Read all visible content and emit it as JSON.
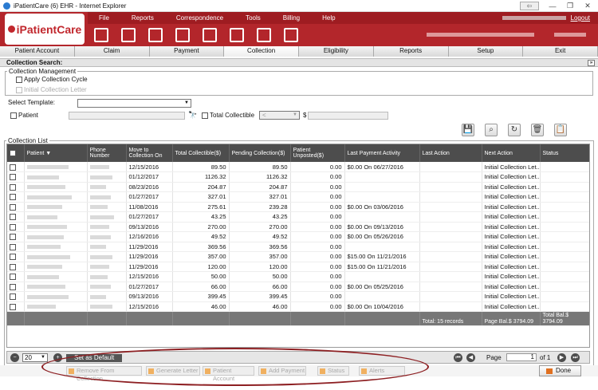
{
  "window": {
    "title": "iPatientCare (6) EHR - Internet Explorer",
    "minimize": "—",
    "restore": "❐",
    "close": "✕"
  },
  "app": {
    "logo": "iPatientCare",
    "menu": [
      "File",
      "Reports",
      "Correspondence",
      "Tools",
      "Billing",
      "Help"
    ],
    "logout": "Logout",
    "toolbar_icons": [
      "clipboard-icon",
      "dashboard-icon",
      "folder-icon",
      "calendar-icon",
      "document-icon",
      "mail-icon",
      "billing-icon",
      "chart-icon"
    ]
  },
  "nav_tabs": [
    "Patient Account",
    "Claim",
    "Payment",
    "Collection",
    "Eligibility",
    "Reports",
    "Setup",
    "Exit"
  ],
  "section_title": "Collection Search:",
  "management": {
    "legend": "Collection Management",
    "apply_cycle": "Apply Collection Cycle",
    "initial_letter": "Initial Collection Letter"
  },
  "filters": {
    "select_template": "Select Template:",
    "patient": "Patient",
    "total_collectible": "Total Collectible",
    "operator": "<",
    "currency": "$"
  },
  "grid": {
    "legend": "Collection List",
    "columns": [
      "",
      "Patient ▼",
      "Phone Number",
      "Move to Collection On",
      "Total Collectible($)",
      "Pending Collection($)",
      "Patient Unposted($)",
      "Last Payment Activity",
      "Last Action",
      "Next Action",
      "Status"
    ],
    "rows": [
      {
        "date": "12/15/2016",
        "total": "89.50",
        "pending": "89.50",
        "unposted": "0.00",
        "last_payment": "$0.00 On 06/27/2016",
        "next": "Initial Collection Let..."
      },
      {
        "date": "01/12/2017",
        "total": "1126.32",
        "pending": "1126.32",
        "unposted": "0.00",
        "last_payment": "",
        "next": "Initial Collection Let..."
      },
      {
        "date": "08/23/2016",
        "total": "204.87",
        "pending": "204.87",
        "unposted": "0.00",
        "last_payment": "",
        "next": "Initial Collection Let..."
      },
      {
        "date": "01/27/2017",
        "total": "327.01",
        "pending": "327.01",
        "unposted": "0.00",
        "last_payment": "",
        "next": "Initial Collection Let..."
      },
      {
        "date": "11/08/2016",
        "total": "275.61",
        "pending": "239.28",
        "unposted": "0.00",
        "last_payment": "$0.00 On 03/06/2016",
        "next": "Initial Collection Let..."
      },
      {
        "date": "01/27/2017",
        "total": "43.25",
        "pending": "43.25",
        "unposted": "0.00",
        "last_payment": "",
        "next": "Initial Collection Let..."
      },
      {
        "date": "09/13/2016",
        "total": "270.00",
        "pending": "270.00",
        "unposted": "0.00",
        "last_payment": "$0.00 On 09/13/2016",
        "next": "Initial Collection Let..."
      },
      {
        "date": "12/16/2016",
        "total": "49.52",
        "pending": "49.52",
        "unposted": "0.00",
        "last_payment": "$0.00 On 05/26/2016",
        "next": "Initial Collection Let..."
      },
      {
        "date": "11/29/2016",
        "total": "369.56",
        "pending": "369.56",
        "unposted": "0.00",
        "last_payment": "",
        "next": "Initial Collection Let..."
      },
      {
        "date": "11/29/2016",
        "total": "357.00",
        "pending": "357.00",
        "unposted": "0.00",
        "last_payment": "$15.00 On 11/21/2016",
        "next": "Initial Collection Let..."
      },
      {
        "date": "11/29/2016",
        "total": "120.00",
        "pending": "120.00",
        "unposted": "0.00",
        "last_payment": "$15.00 On 11/21/2016",
        "next": "Initial Collection Let..."
      },
      {
        "date": "12/15/2016",
        "total": "50.00",
        "pending": "50.00",
        "unposted": "0.00",
        "last_payment": "",
        "next": "Initial Collection Let..."
      },
      {
        "date": "01/27/2017",
        "total": "66.00",
        "pending": "66.00",
        "unposted": "0.00",
        "last_payment": "$0.00 On 05/25/2016",
        "next": "Initial Collection Let..."
      },
      {
        "date": "09/13/2016",
        "total": "399.45",
        "pending": "399.45",
        "unposted": "0.00",
        "last_payment": "",
        "next": "Initial Collection Let..."
      },
      {
        "date": "12/15/2016",
        "total": "46.00",
        "pending": "46.00",
        "unposted": "0.00",
        "last_payment": "$0.00 On 10/04/2016",
        "next": "Initial Collection Let..."
      }
    ],
    "totals": {
      "records": "Total: 15 records",
      "page_bal": "Page Bal.$ 3794.09",
      "total_bal": "Total Bal.$ 3794.09"
    }
  },
  "pager": {
    "page_size": "20",
    "set_default": "Set as Default",
    "page_label": "Page",
    "page_value": "1",
    "of": "of 1"
  },
  "actions": [
    "Remove From Collection",
    "Generate Letter",
    "Patient Account",
    "Add Payment",
    "Status",
    "Alerts"
  ],
  "done": "Done"
}
